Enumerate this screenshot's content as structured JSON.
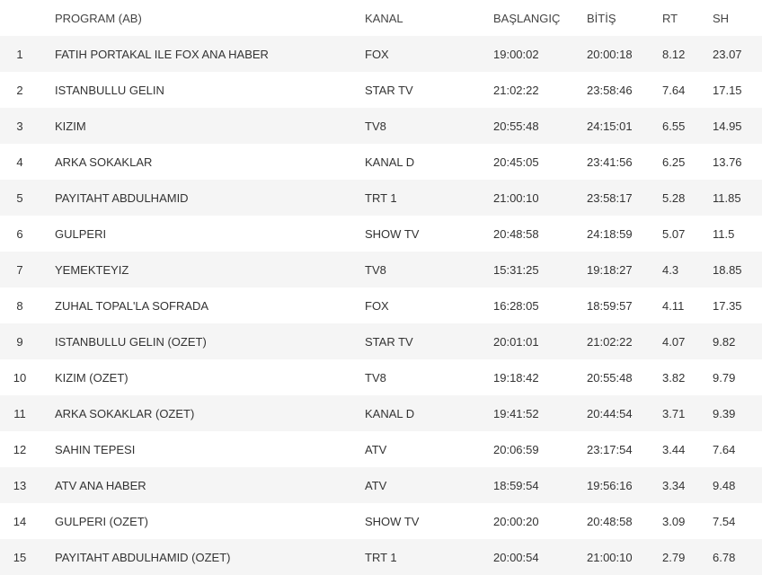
{
  "table": {
    "headers": {
      "rank": "",
      "program": "PROGRAM (AB)",
      "channel": "KANAL",
      "start": "BAŞLANGIÇ",
      "end": "BİTİŞ",
      "rt": "RT",
      "sh": "SH"
    },
    "rows": [
      {
        "rank": "1",
        "program": "FATIH PORTAKAL ILE FOX ANA HABER",
        "channel": "FOX",
        "start": "19:00:02",
        "end": "20:00:18",
        "rt": "8.12",
        "sh": "23.07"
      },
      {
        "rank": "2",
        "program": "ISTANBULLU GELIN",
        "channel": "STAR TV",
        "start": "21:02:22",
        "end": "23:58:46",
        "rt": "7.64",
        "sh": "17.15"
      },
      {
        "rank": "3",
        "program": "KIZIM",
        "channel": "TV8",
        "start": "20:55:48",
        "end": "24:15:01",
        "rt": "6.55",
        "sh": "14.95"
      },
      {
        "rank": "4",
        "program": "ARKA SOKAKLAR",
        "channel": "KANAL D",
        "start": "20:45:05",
        "end": "23:41:56",
        "rt": "6.25",
        "sh": "13.76"
      },
      {
        "rank": "5",
        "program": "PAYITAHT ABDULHAMID",
        "channel": "TRT 1",
        "start": "21:00:10",
        "end": "23:58:17",
        "rt": "5.28",
        "sh": "11.85"
      },
      {
        "rank": "6",
        "program": "GULPERI",
        "channel": "SHOW TV",
        "start": "20:48:58",
        "end": "24:18:59",
        "rt": "5.07",
        "sh": "11.5"
      },
      {
        "rank": "7",
        "program": "YEMEKTEYIZ",
        "channel": "TV8",
        "start": "15:31:25",
        "end": "19:18:27",
        "rt": "4.3",
        "sh": "18.85"
      },
      {
        "rank": "8",
        "program": "ZUHAL TOPAL'LA SOFRADA",
        "channel": "FOX",
        "start": "16:28:05",
        "end": "18:59:57",
        "rt": "4.11",
        "sh": "17.35"
      },
      {
        "rank": "9",
        "program": "ISTANBULLU GELIN (OZET)",
        "channel": "STAR TV",
        "start": "20:01:01",
        "end": "21:02:22",
        "rt": "4.07",
        "sh": "9.82"
      },
      {
        "rank": "10",
        "program": "KIZIM (OZET)",
        "channel": "TV8",
        "start": "19:18:42",
        "end": "20:55:48",
        "rt": "3.82",
        "sh": "9.79"
      },
      {
        "rank": "11",
        "program": "ARKA SOKAKLAR (OZET)",
        "channel": "KANAL D",
        "start": "19:41:52",
        "end": "20:44:54",
        "rt": "3.71",
        "sh": "9.39"
      },
      {
        "rank": "12",
        "program": "SAHIN TEPESI",
        "channel": "ATV",
        "start": "20:06:59",
        "end": "23:17:54",
        "rt": "3.44",
        "sh": "7.64"
      },
      {
        "rank": "13",
        "program": "ATV ANA HABER",
        "channel": "ATV",
        "start": "18:59:54",
        "end": "19:56:16",
        "rt": "3.34",
        "sh": "9.48"
      },
      {
        "rank": "14",
        "program": "GULPERI (OZET)",
        "channel": "SHOW TV",
        "start": "20:00:20",
        "end": "20:48:58",
        "rt": "3.09",
        "sh": "7.54"
      },
      {
        "rank": "15",
        "program": "PAYITAHT ABDULHAMID (OZET)",
        "channel": "TRT 1",
        "start": "20:00:54",
        "end": "21:00:10",
        "rt": "2.79",
        "sh": "6.78"
      }
    ]
  }
}
